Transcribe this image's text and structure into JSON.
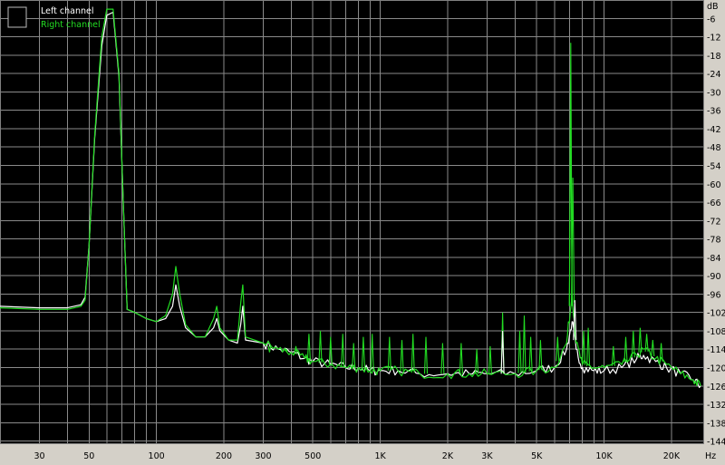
{
  "chart_data": {
    "type": "line",
    "title": "",
    "xlabel": "Hz",
    "ylabel": "dB",
    "x_scale": "log",
    "xlim": [
      20,
      28000
    ],
    "ylim": [
      -145,
      0
    ],
    "grid": true,
    "background": "#000000",
    "grid_color": "#8a8a8a",
    "legend_position": "top-left",
    "y_ticks": [
      -6,
      -12,
      -18,
      -24,
      -30,
      -36,
      -42,
      -48,
      -54,
      -60,
      -66,
      -72,
      -78,
      -84,
      -90,
      -96,
      -102,
      -108,
      -114,
      -120,
      -126,
      -132,
      -138,
      -144
    ],
    "x_ticks": [
      {
        "value": 30,
        "label": "30"
      },
      {
        "value": 50,
        "label": "50"
      },
      {
        "value": 100,
        "label": "100"
      },
      {
        "value": 200,
        "label": "200"
      },
      {
        "value": 300,
        "label": "300"
      },
      {
        "value": 500,
        "label": "500"
      },
      {
        "value": 1000,
        "label": "1K"
      },
      {
        "value": 2000,
        "label": "2K"
      },
      {
        "value": 3000,
        "label": "3K"
      },
      {
        "value": 5000,
        "label": "5K"
      },
      {
        "value": 10000,
        "label": "10K"
      },
      {
        "value": 20000,
        "label": "20K"
      }
    ],
    "series": [
      {
        "name": "Left channel",
        "color": "#ffffff",
        "points": [
          [
            20,
            -100
          ],
          [
            30,
            -100.5
          ],
          [
            40,
            -100.5
          ],
          [
            46,
            -99.5
          ],
          [
            48,
            -97
          ],
          [
            50,
            -80
          ],
          [
            53,
            -45
          ],
          [
            57,
            -15
          ],
          [
            60,
            -5
          ],
          [
            64,
            -4
          ],
          [
            68,
            -25
          ],
          [
            71,
            -65
          ],
          [
            74,
            -101
          ],
          [
            80,
            -102
          ],
          [
            90,
            -104
          ],
          [
            100,
            -105
          ],
          [
            110,
            -104
          ],
          [
            118,
            -100
          ],
          [
            122,
            -93
          ],
          [
            127,
            -100
          ],
          [
            135,
            -107
          ],
          [
            150,
            -110
          ],
          [
            165,
            -110
          ],
          [
            180,
            -107
          ],
          [
            186,
            -104
          ],
          [
            192,
            -108
          ],
          [
            210,
            -111
          ],
          [
            230,
            -112
          ],
          [
            238,
            -106
          ],
          [
            243,
            -100
          ],
          [
            250,
            -111
          ],
          [
            300,
            -112
          ],
          [
            350,
            -114
          ],
          [
            400,
            -115
          ],
          [
            460,
            -117
          ],
          [
            500,
            -118
          ],
          [
            600,
            -119
          ],
          [
            700,
            -120
          ],
          [
            800,
            -120
          ],
          [
            900,
            -121
          ],
          [
            1000,
            -121
          ],
          [
            1200,
            -121
          ],
          [
            1500,
            -122
          ],
          [
            2000,
            -122
          ],
          [
            2500,
            -122
          ],
          [
            3000,
            -122
          ],
          [
            4000,
            -122
          ],
          [
            5000,
            -121
          ],
          [
            6000,
            -120
          ],
          [
            6800,
            -114
          ],
          [
            7200,
            -105
          ],
          [
            7500,
            -114
          ],
          [
            8000,
            -120
          ],
          [
            9000,
            -121
          ],
          [
            10000,
            -121
          ],
          [
            12000,
            -120
          ],
          [
            14000,
            -117
          ],
          [
            15000,
            -116
          ],
          [
            17000,
            -118
          ],
          [
            19000,
            -120
          ],
          [
            22000,
            -122
          ],
          [
            25000,
            -124
          ],
          [
            27000,
            -126
          ]
        ]
      },
      {
        "name": "Right channel",
        "color": "#22dd22",
        "points": [
          [
            20,
            -100.5
          ],
          [
            30,
            -101
          ],
          [
            40,
            -101
          ],
          [
            46,
            -100
          ],
          [
            48,
            -98
          ],
          [
            50,
            -80
          ],
          [
            53,
            -44
          ],
          [
            57,
            -12
          ],
          [
            60,
            -3
          ],
          [
            64,
            -3
          ],
          [
            68,
            -24
          ],
          [
            71,
            -65
          ],
          [
            74,
            -101
          ],
          [
            80,
            -102
          ],
          [
            90,
            -104
          ],
          [
            100,
            -105
          ],
          [
            110,
            -103
          ],
          [
            118,
            -96
          ],
          [
            122,
            -87
          ],
          [
            127,
            -96
          ],
          [
            135,
            -106
          ],
          [
            150,
            -110
          ],
          [
            165,
            -110
          ],
          [
            180,
            -104
          ],
          [
            186,
            -100
          ],
          [
            192,
            -107
          ],
          [
            210,
            -111
          ],
          [
            230,
            -111
          ],
          [
            238,
            -99
          ],
          [
            243,
            -93
          ],
          [
            250,
            -110
          ],
          [
            300,
            -112
          ],
          [
            350,
            -114
          ],
          [
            400,
            -115
          ],
          [
            460,
            -117
          ],
          [
            500,
            -118
          ],
          [
            600,
            -119
          ],
          [
            700,
            -120
          ],
          [
            800,
            -120
          ],
          [
            900,
            -121
          ],
          [
            1000,
            -121
          ],
          [
            1200,
            -121
          ],
          [
            1500,
            -122
          ],
          [
            2000,
            -122
          ],
          [
            2500,
            -122
          ],
          [
            3000,
            -122
          ],
          [
            4000,
            -122
          ],
          [
            5000,
            -121
          ],
          [
            6000,
            -120
          ],
          [
            6800,
            -112
          ],
          [
            7200,
            -96
          ],
          [
            7500,
            -112
          ],
          [
            8000,
            -119
          ],
          [
            9000,
            -120
          ],
          [
            10000,
            -120
          ],
          [
            12000,
            -119
          ],
          [
            14000,
            -116
          ],
          [
            15000,
            -114
          ],
          [
            17000,
            -117
          ],
          [
            19000,
            -119
          ],
          [
            22000,
            -122
          ],
          [
            25000,
            -124
          ],
          [
            27000,
            -126
          ]
        ]
      }
    ],
    "spikes": [
      {
        "freq": 7100,
        "db": -14,
        "series": 1
      },
      {
        "freq": 7100,
        "db": -37,
        "series": 1
      },
      {
        "freq": 7250,
        "db": -58,
        "series": 1
      },
      {
        "freq": 7400,
        "db": -98,
        "series": 0
      },
      {
        "freq": 3520,
        "db": -102,
        "series": 1
      },
      {
        "freq": 3520,
        "db": -108,
        "series": 0
      },
      {
        "freq": 4200,
        "db": -108,
        "series": 1
      },
      {
        "freq": 4400,
        "db": -103,
        "series": 1
      },
      {
        "freq": 4700,
        "db": -110,
        "series": 1
      },
      {
        "freq": 5200,
        "db": -111,
        "series": 1
      },
      {
        "freq": 6200,
        "db": -110,
        "series": 1
      },
      {
        "freq": 8100,
        "db": -108,
        "series": 1
      },
      {
        "freq": 8500,
        "db": -107,
        "series": 1
      },
      {
        "freq": 480,
        "db": -109,
        "series": 1
      },
      {
        "freq": 540,
        "db": -108,
        "series": 1
      },
      {
        "freq": 600,
        "db": -110,
        "series": 1
      },
      {
        "freq": 680,
        "db": -109,
        "series": 1
      },
      {
        "freq": 760,
        "db": -112,
        "series": 1
      },
      {
        "freq": 840,
        "db": -110,
        "series": 1
      },
      {
        "freq": 920,
        "db": -109,
        "series": 1
      },
      {
        "freq": 1100,
        "db": -110,
        "series": 1
      },
      {
        "freq": 1250,
        "db": -111,
        "series": 1
      },
      {
        "freq": 1400,
        "db": -109,
        "series": 1
      },
      {
        "freq": 1600,
        "db": -110,
        "series": 1
      },
      {
        "freq": 1900,
        "db": -112,
        "series": 1
      },
      {
        "freq": 2300,
        "db": -112,
        "series": 1
      },
      {
        "freq": 2700,
        "db": -114,
        "series": 1
      },
      {
        "freq": 3100,
        "db": -113,
        "series": 1
      },
      {
        "freq": 12500,
        "db": -110,
        "series": 1
      },
      {
        "freq": 13500,
        "db": -108,
        "series": 1
      },
      {
        "freq": 14500,
        "db": -107,
        "series": 1
      },
      {
        "freq": 15500,
        "db": -109,
        "series": 1
      },
      {
        "freq": 16500,
        "db": -111,
        "series": 1
      },
      {
        "freq": 18000,
        "db": -112,
        "series": 1
      },
      {
        "freq": 11000,
        "db": -113,
        "series": 1
      },
      {
        "freq": 380,
        "db": -114,
        "series": 1
      },
      {
        "freq": 420,
        "db": -113,
        "series": 1
      },
      {
        "freq": 320,
        "db": -115,
        "series": 1
      }
    ]
  }
}
